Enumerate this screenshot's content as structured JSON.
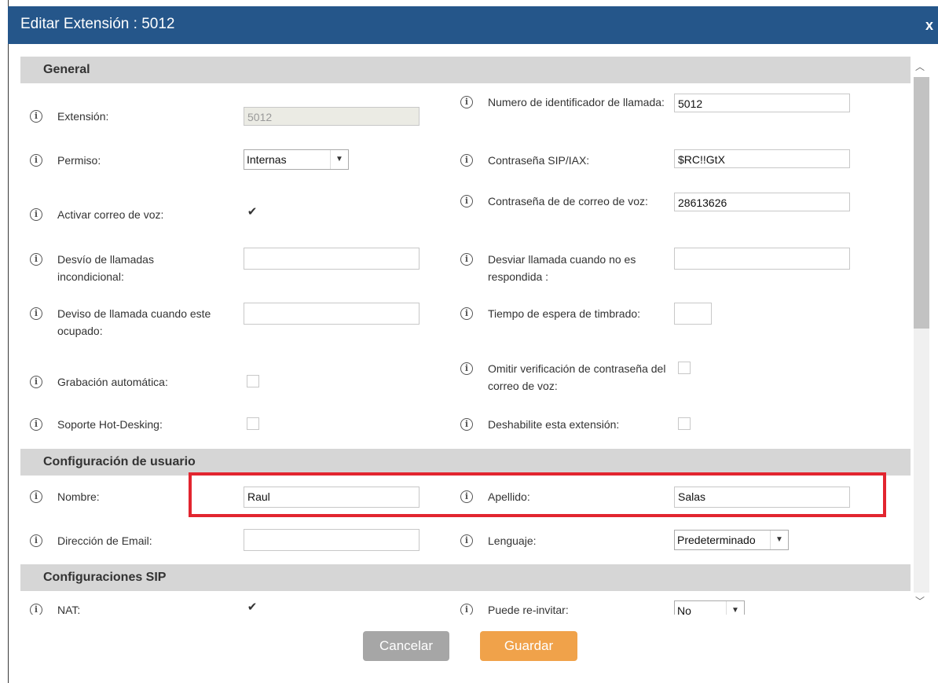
{
  "dialog": {
    "title": "Editar Extensión : 5012",
    "close_label": "x"
  },
  "sections": {
    "general": "General",
    "user_config": "Configuración de usuario",
    "sip_config": "Configuraciones SIP"
  },
  "general": {
    "extension_label": "Extensión:",
    "extension_value": "5012",
    "callerid_label": "Numero de identificador de llamada:",
    "callerid_value": "5012",
    "permission_label": "Permiso:",
    "permission_value": "Internas",
    "sip_password_label": "Contraseña SIP/IAX:",
    "sip_password_value": "$RC!!GtX",
    "voicemail_label": "Activar correo de voz:",
    "voicemail_checked": true,
    "voicemail_password_label": "Contraseña de de correo de voz:",
    "voicemail_password_value": "28613626",
    "unconditional_forward_label": "Desvío de llamadas incondicional:",
    "noanswer_forward_label": "Desviar llamada cuando no es respondida :",
    "busy_forward_label": "Deviso de llamada cuando este ocupado:",
    "ring_timeout_label": "Tiempo de espera de timbrado:",
    "auto_record_label": "Grabación automática:",
    "skip_vm_password_label": "Omitir verificación de contraseña del correo de voz:",
    "hot_desking_label": "Soporte Hot-Desking:",
    "disable_extension_label": "Deshabilite esta extensión:"
  },
  "user": {
    "first_name_label": "Nombre:",
    "first_name_value": "Raul",
    "last_name_label": "Apellido:",
    "last_name_value": "Salas",
    "email_label": "Dirección de Email:",
    "language_label": "Lenguaje:",
    "language_value": "Predeterminado"
  },
  "sip": {
    "nat_label": "NAT:",
    "reinvite_label": "Puede re-invitar:",
    "reinvite_value": "No"
  },
  "buttons": {
    "cancel": "Cancelar",
    "save": "Guardar"
  },
  "colors": {
    "titlebar": "#25568a",
    "highlight": "#e2252f",
    "save": "#f0a24a",
    "cancel": "#a6a6a6"
  }
}
